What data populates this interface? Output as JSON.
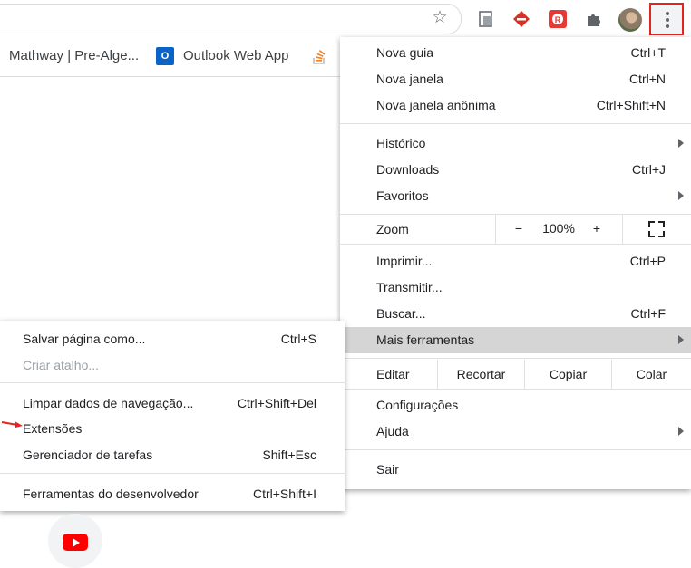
{
  "toolbar": {
    "star_icon": "star-icon",
    "extensions": [
      "screenshot-extension-icon",
      "red-diamond-extension-icon",
      "red-r-extension-icon",
      "puzzle-extensions-icon"
    ],
    "menu_icon": "three-dots-vertical-icon"
  },
  "bookmarks": [
    {
      "label": "Mathway | Pre-Alge..."
    },
    {
      "label": "Outlook Web App"
    }
  ],
  "menu": {
    "group1": [
      {
        "label": "Nova guia",
        "shortcut": "Ctrl+T"
      },
      {
        "label": "Nova janela",
        "shortcut": "Ctrl+N"
      },
      {
        "label": "Nova janela anônima",
        "shortcut": "Ctrl+Shift+N"
      }
    ],
    "group2": [
      {
        "label": "Histórico",
        "shortcut": ""
      },
      {
        "label": "Downloads",
        "shortcut": "Ctrl+J"
      },
      {
        "label": "Favoritos",
        "shortcut": ""
      }
    ],
    "zoom": {
      "label": "Zoom",
      "minus": "−",
      "value": "100%",
      "plus": "+"
    },
    "group3": [
      {
        "label": "Imprimir...",
        "shortcut": "Ctrl+P"
      },
      {
        "label": "Transmitir...",
        "shortcut": ""
      },
      {
        "label": "Buscar...",
        "shortcut": "Ctrl+F"
      },
      {
        "label": "Mais ferramentas",
        "shortcut": ""
      }
    ],
    "edit": {
      "label": "Editar",
      "cut": "Recortar",
      "copy": "Copiar",
      "paste": "Colar"
    },
    "group4": [
      {
        "label": "Configurações",
        "shortcut": ""
      },
      {
        "label": "Ajuda",
        "shortcut": ""
      }
    ],
    "exit": {
      "label": "Sair"
    }
  },
  "submenu": {
    "items": [
      {
        "label": "Salvar página como...",
        "shortcut": "Ctrl+S"
      },
      {
        "label": "Criar atalho...",
        "shortcut": ""
      },
      {
        "label": "Limpar dados de navegação...",
        "shortcut": "Ctrl+Shift+Del"
      },
      {
        "label": "Extensões",
        "shortcut": ""
      },
      {
        "label": "Gerenciador de tarefas",
        "shortcut": "Shift+Esc"
      },
      {
        "label": "Ferramentas do desenvolvedor",
        "shortcut": "Ctrl+Shift+I"
      }
    ]
  },
  "colors": {
    "highlight": "#d5d5d5",
    "accent_red": "#e5241f"
  }
}
